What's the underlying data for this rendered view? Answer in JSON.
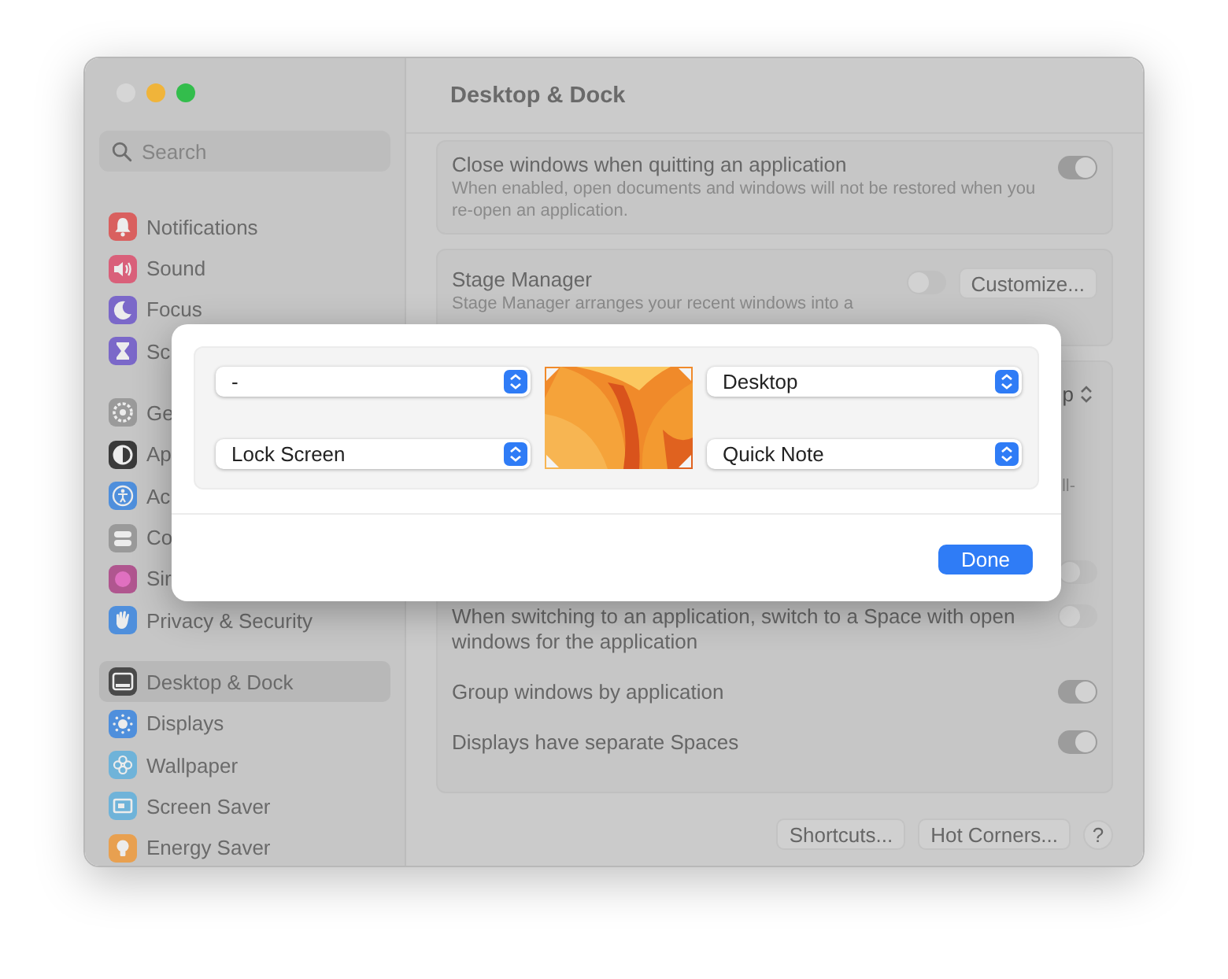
{
  "window": {
    "title": "Desktop & Dock",
    "traffic_lights": [
      {
        "color": "#d6d6d6"
      },
      {
        "color": "#f0b43a"
      },
      {
        "color": "#33bd4c"
      }
    ]
  },
  "sidebar": {
    "search": {
      "placeholder": "Search"
    },
    "groups": [
      [
        {
          "label": "Notifications",
          "kind": "bell",
          "color": "#d9605f",
          "selected": false
        },
        {
          "label": "Sound",
          "kind": "speaker",
          "color": "#d9607a",
          "selected": false
        },
        {
          "label": "Focus",
          "kind": "moon",
          "color": "#7b68c9",
          "selected": false
        },
        {
          "label": "Sc",
          "kind": "hourglass",
          "color": "#7b68c9",
          "selected": false
        }
      ],
      [
        {
          "label": "Ge",
          "kind": "gear",
          "color": "#9a9a9a",
          "selected": false
        },
        {
          "label": "Ap",
          "kind": "halfcircle",
          "color": "#3a3a3a",
          "selected": false
        },
        {
          "label": "Ac",
          "kind": "person",
          "color": "#4f8fdc",
          "selected": false
        },
        {
          "label": "Co",
          "kind": "switches",
          "color": "#9a9a9a",
          "selected": false
        },
        {
          "label": "Sir",
          "kind": "orb",
          "color": "#b0568f",
          "selected": false
        },
        {
          "label": "Privacy & Security",
          "kind": "hand",
          "color": "#4f8fdc",
          "selected": false
        }
      ],
      [
        {
          "label": "Desktop & Dock",
          "kind": "dock",
          "color": "#4a4a4a",
          "selected": true
        },
        {
          "label": "Displays",
          "kind": "sun",
          "color": "#4f8fdc",
          "selected": false
        },
        {
          "label": "Wallpaper",
          "kind": "flower",
          "color": "#6fb3d9",
          "selected": false
        },
        {
          "label": "Screen Saver",
          "kind": "screen",
          "color": "#6fb3d9",
          "selected": false
        },
        {
          "label": "Energy Saver",
          "kind": "bulb",
          "color": "#e8a050",
          "selected": false
        }
      ]
    ]
  },
  "settings": {
    "close_windows": {
      "title": "Close windows when quitting an application",
      "description": "When enabled, open documents and windows will not be restored when you re-open an application.",
      "on": true
    },
    "stage_manager": {
      "title": "Stage Manager",
      "description": "Stage Manager arranges your recent windows into a",
      "on": false,
      "button": "Customize..."
    },
    "partly_hidden": {
      "popup_fragment": "p",
      "description_fragment": "ll-",
      "toggle_on": false
    },
    "rows": [
      {
        "label": "When switching to an application, switch to a Space with open windows for the application",
        "on": false
      },
      {
        "label": "Group windows by application",
        "on": true
      },
      {
        "label": "Displays have separate Spaces",
        "on": true
      }
    ]
  },
  "footer_buttons": [
    "Shortcuts...",
    "Hot Corners...",
    "?"
  ],
  "dialog": {
    "corners": [
      {
        "value": "-"
      },
      {
        "value": "Desktop"
      },
      {
        "value": "Lock Screen"
      },
      {
        "value": "Quick Note"
      }
    ],
    "done": "Done"
  }
}
